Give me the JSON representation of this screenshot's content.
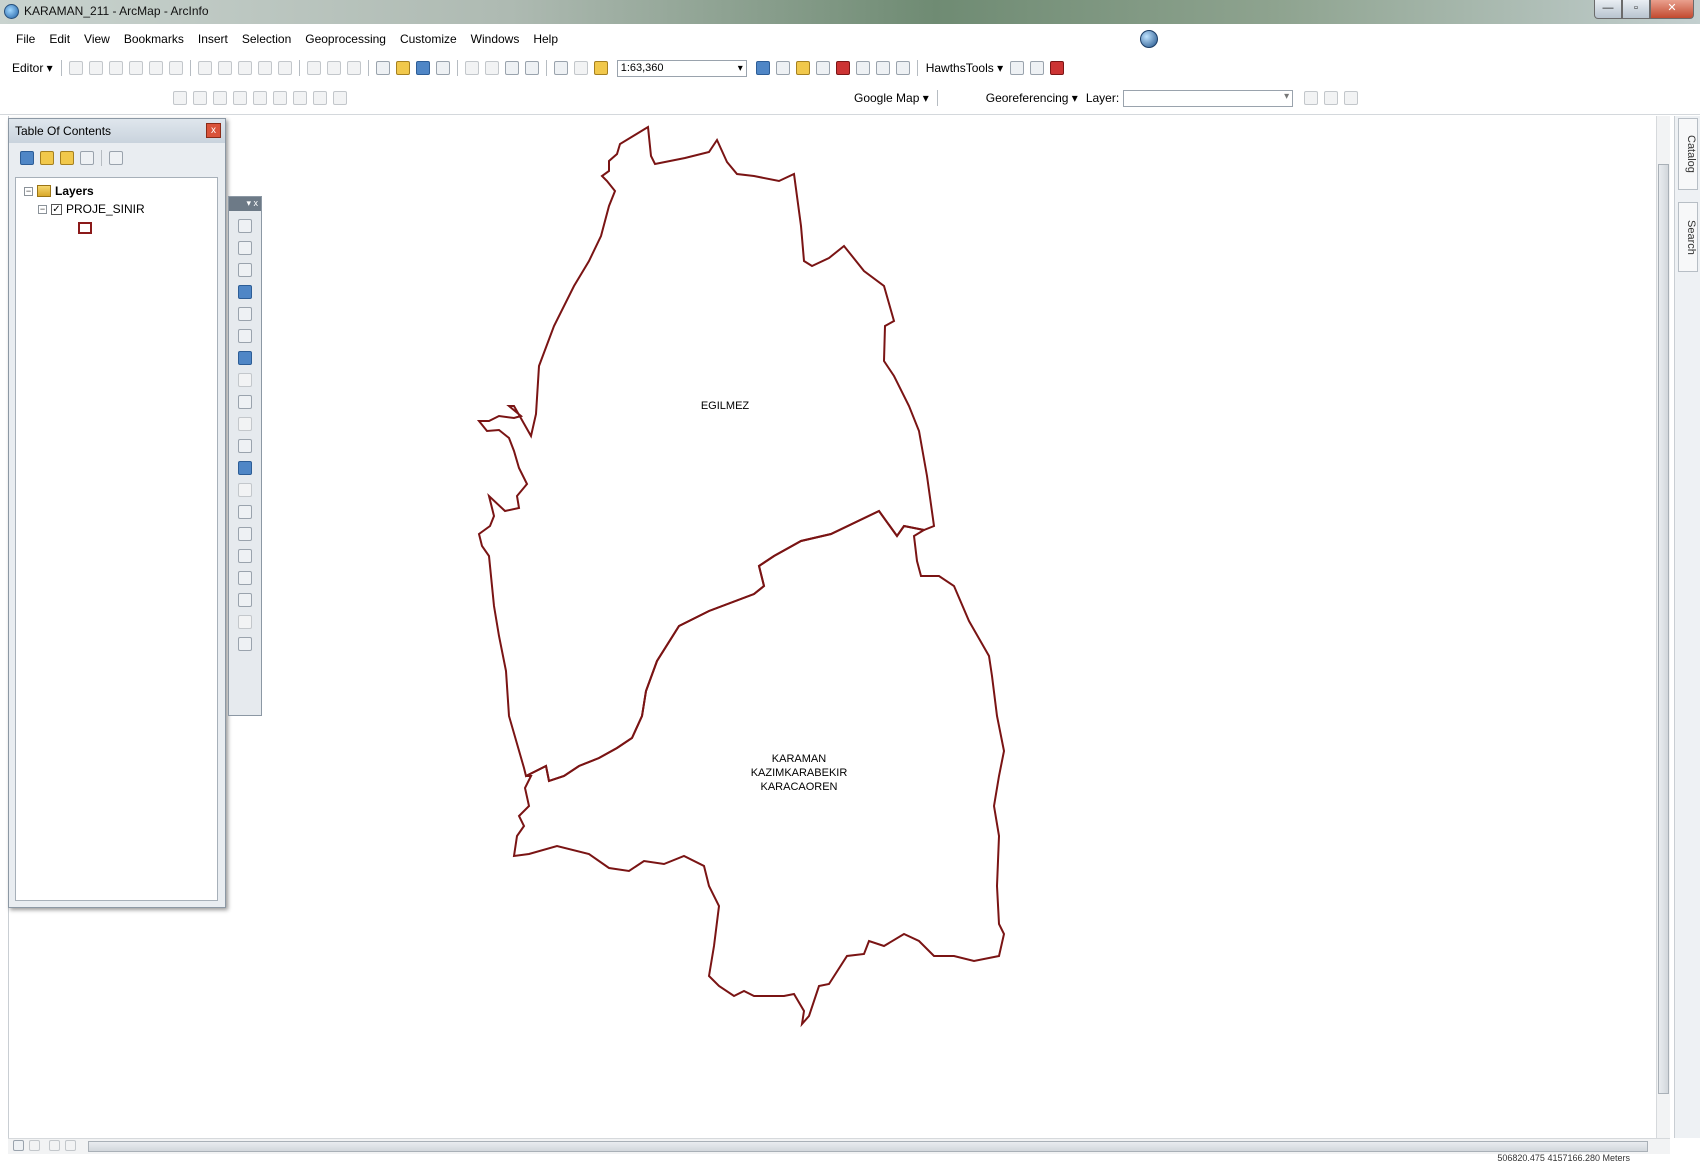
{
  "window": {
    "title": "KARAMAN_211 - ArcMap - ArcInfo"
  },
  "menu": [
    "File",
    "Edit",
    "View",
    "Bookmarks",
    "Insert",
    "Selection",
    "Geoprocessing",
    "Customize",
    "Windows",
    "Help"
  ],
  "toolbar": {
    "editor_label": "Editor ▾",
    "scale_value": "1:63,360",
    "hawths_label": "HawthsTools ▾",
    "google_label": "Google Map ▾",
    "georef_label": "Georeferencing ▾",
    "layer_label": "Layer:"
  },
  "toc": {
    "title": "Table Of Contents",
    "root_label": "Layers",
    "layer_name": "PROJE_SINIR",
    "close_glyph": "x"
  },
  "tools_palette": {
    "header_glyphs": "▾ x"
  },
  "map": {
    "label_north": "EGILMEZ",
    "label_south_lines": [
      "KARAMAN",
      "KAZIMKARABEKIR",
      "KARACAOREN"
    ],
    "boundary_color": "#7a1414"
  },
  "dock": {
    "catalog_label": "Catalog",
    "search_label": "Search"
  },
  "status": {
    "coordinates": "506820.475 4157166.280 Meters"
  }
}
